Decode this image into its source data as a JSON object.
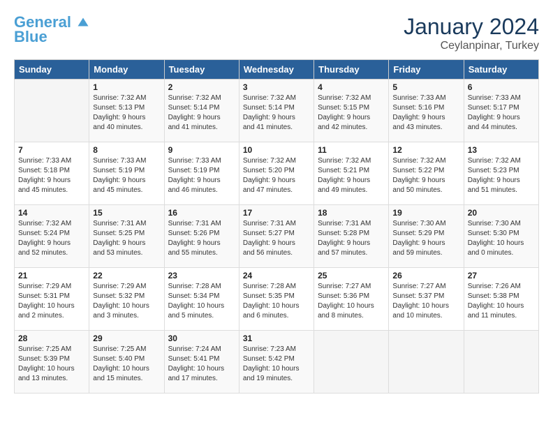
{
  "header": {
    "logo_line1": "General",
    "logo_line2": "Blue",
    "month_year": "January 2024",
    "location": "Ceylanpinar, Turkey"
  },
  "days_header": [
    "Sunday",
    "Monday",
    "Tuesday",
    "Wednesday",
    "Thursday",
    "Friday",
    "Saturday"
  ],
  "weeks": [
    [
      {
        "day": "",
        "info": ""
      },
      {
        "day": "1",
        "info": "Sunrise: 7:32 AM\nSunset: 5:13 PM\nDaylight: 9 hours\nand 40 minutes."
      },
      {
        "day": "2",
        "info": "Sunrise: 7:32 AM\nSunset: 5:14 PM\nDaylight: 9 hours\nand 41 minutes."
      },
      {
        "day": "3",
        "info": "Sunrise: 7:32 AM\nSunset: 5:14 PM\nDaylight: 9 hours\nand 41 minutes."
      },
      {
        "day": "4",
        "info": "Sunrise: 7:32 AM\nSunset: 5:15 PM\nDaylight: 9 hours\nand 42 minutes."
      },
      {
        "day": "5",
        "info": "Sunrise: 7:33 AM\nSunset: 5:16 PM\nDaylight: 9 hours\nand 43 minutes."
      },
      {
        "day": "6",
        "info": "Sunrise: 7:33 AM\nSunset: 5:17 PM\nDaylight: 9 hours\nand 44 minutes."
      }
    ],
    [
      {
        "day": "7",
        "info": "Sunrise: 7:33 AM\nSunset: 5:18 PM\nDaylight: 9 hours\nand 45 minutes."
      },
      {
        "day": "8",
        "info": "Sunrise: 7:33 AM\nSunset: 5:19 PM\nDaylight: 9 hours\nand 45 minutes."
      },
      {
        "day": "9",
        "info": "Sunrise: 7:33 AM\nSunset: 5:19 PM\nDaylight: 9 hours\nand 46 minutes."
      },
      {
        "day": "10",
        "info": "Sunrise: 7:32 AM\nSunset: 5:20 PM\nDaylight: 9 hours\nand 47 minutes."
      },
      {
        "day": "11",
        "info": "Sunrise: 7:32 AM\nSunset: 5:21 PM\nDaylight: 9 hours\nand 49 minutes."
      },
      {
        "day": "12",
        "info": "Sunrise: 7:32 AM\nSunset: 5:22 PM\nDaylight: 9 hours\nand 50 minutes."
      },
      {
        "day": "13",
        "info": "Sunrise: 7:32 AM\nSunset: 5:23 PM\nDaylight: 9 hours\nand 51 minutes."
      }
    ],
    [
      {
        "day": "14",
        "info": "Sunrise: 7:32 AM\nSunset: 5:24 PM\nDaylight: 9 hours\nand 52 minutes."
      },
      {
        "day": "15",
        "info": "Sunrise: 7:31 AM\nSunset: 5:25 PM\nDaylight: 9 hours\nand 53 minutes."
      },
      {
        "day": "16",
        "info": "Sunrise: 7:31 AM\nSunset: 5:26 PM\nDaylight: 9 hours\nand 55 minutes."
      },
      {
        "day": "17",
        "info": "Sunrise: 7:31 AM\nSunset: 5:27 PM\nDaylight: 9 hours\nand 56 minutes."
      },
      {
        "day": "18",
        "info": "Sunrise: 7:31 AM\nSunset: 5:28 PM\nDaylight: 9 hours\nand 57 minutes."
      },
      {
        "day": "19",
        "info": "Sunrise: 7:30 AM\nSunset: 5:29 PM\nDaylight: 9 hours\nand 59 minutes."
      },
      {
        "day": "20",
        "info": "Sunrise: 7:30 AM\nSunset: 5:30 PM\nDaylight: 10 hours\nand 0 minutes."
      }
    ],
    [
      {
        "day": "21",
        "info": "Sunrise: 7:29 AM\nSunset: 5:31 PM\nDaylight: 10 hours\nand 2 minutes."
      },
      {
        "day": "22",
        "info": "Sunrise: 7:29 AM\nSunset: 5:32 PM\nDaylight: 10 hours\nand 3 minutes."
      },
      {
        "day": "23",
        "info": "Sunrise: 7:28 AM\nSunset: 5:34 PM\nDaylight: 10 hours\nand 5 minutes."
      },
      {
        "day": "24",
        "info": "Sunrise: 7:28 AM\nSunset: 5:35 PM\nDaylight: 10 hours\nand 6 minutes."
      },
      {
        "day": "25",
        "info": "Sunrise: 7:27 AM\nSunset: 5:36 PM\nDaylight: 10 hours\nand 8 minutes."
      },
      {
        "day": "26",
        "info": "Sunrise: 7:27 AM\nSunset: 5:37 PM\nDaylight: 10 hours\nand 10 minutes."
      },
      {
        "day": "27",
        "info": "Sunrise: 7:26 AM\nSunset: 5:38 PM\nDaylight: 10 hours\nand 11 minutes."
      }
    ],
    [
      {
        "day": "28",
        "info": "Sunrise: 7:25 AM\nSunset: 5:39 PM\nDaylight: 10 hours\nand 13 minutes."
      },
      {
        "day": "29",
        "info": "Sunrise: 7:25 AM\nSunset: 5:40 PM\nDaylight: 10 hours\nand 15 minutes."
      },
      {
        "day": "30",
        "info": "Sunrise: 7:24 AM\nSunset: 5:41 PM\nDaylight: 10 hours\nand 17 minutes."
      },
      {
        "day": "31",
        "info": "Sunrise: 7:23 AM\nSunset: 5:42 PM\nDaylight: 10 hours\nand 19 minutes."
      },
      {
        "day": "",
        "info": ""
      },
      {
        "day": "",
        "info": ""
      },
      {
        "day": "",
        "info": ""
      }
    ]
  ]
}
